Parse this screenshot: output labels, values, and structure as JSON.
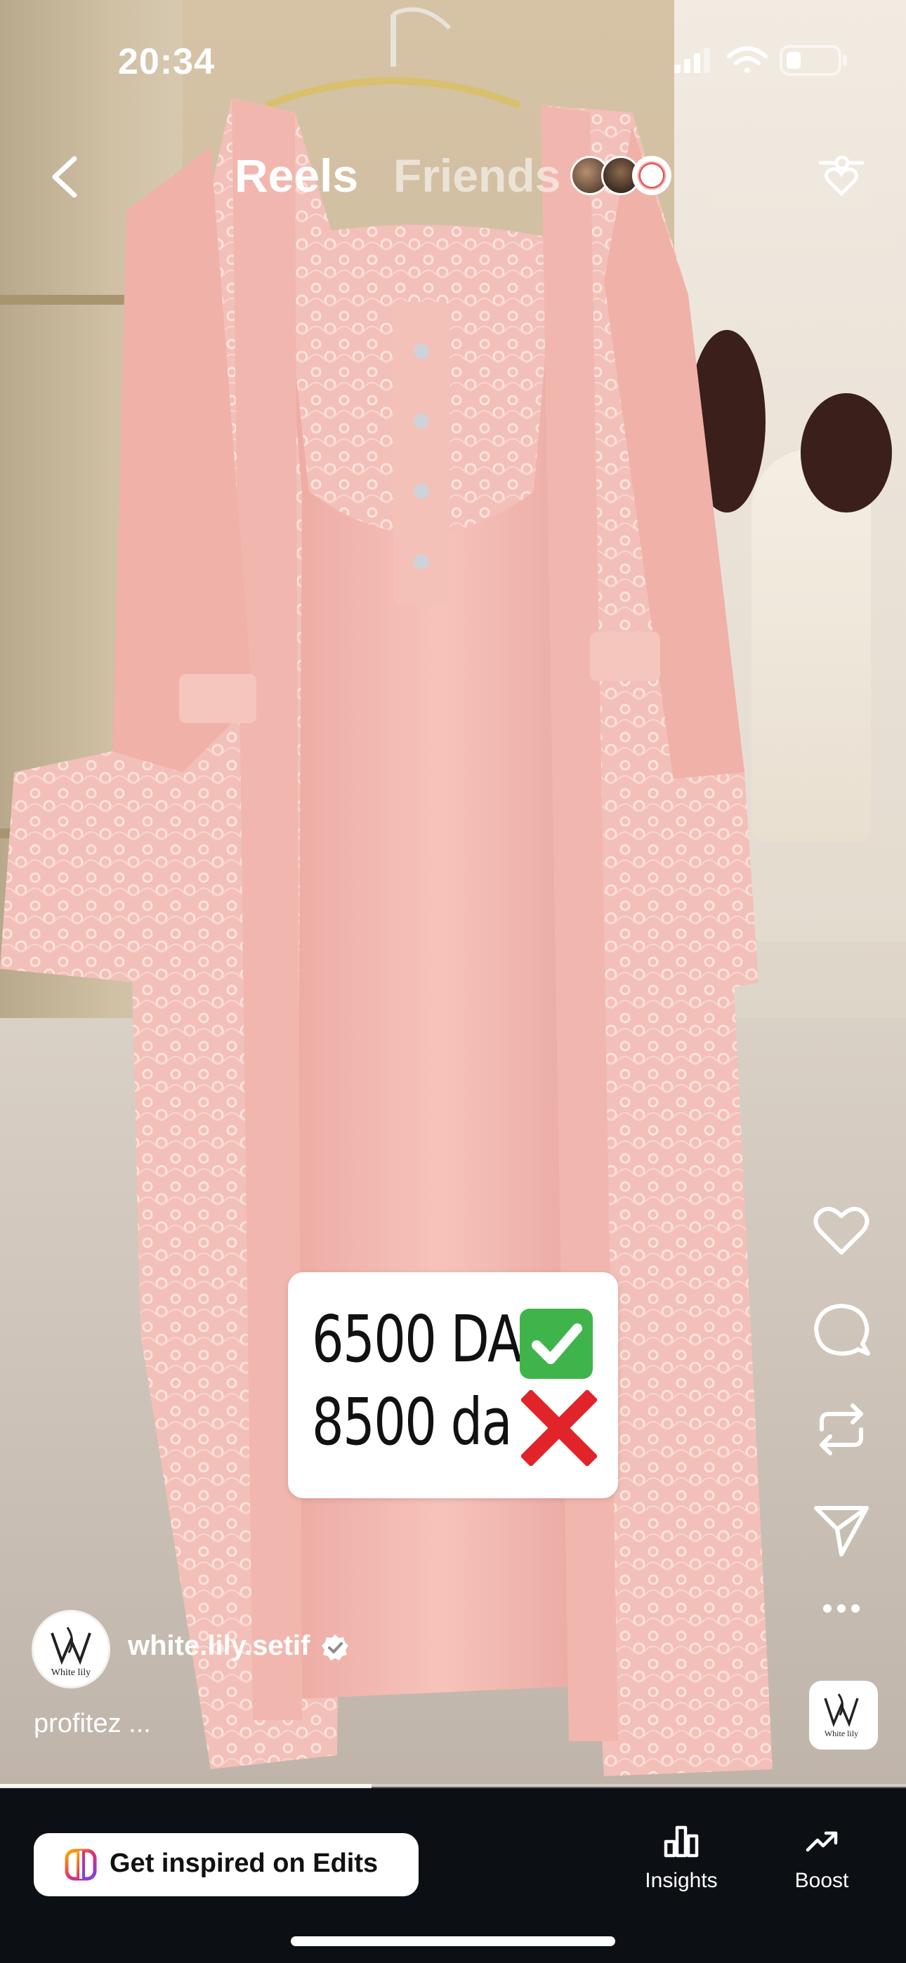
{
  "status_bar": {
    "time": "20:34"
  },
  "top_bar": {
    "tabs": [
      {
        "label": "Reels",
        "active": true
      },
      {
        "label": "Friends",
        "active": false
      }
    ]
  },
  "post": {
    "price_sticker": {
      "line1": "6500 DA",
      "line2": "8500 da"
    },
    "author": {
      "username": "white.lily.setif",
      "verified": true,
      "avatar_text": "White lily"
    },
    "caption": "profitez ...",
    "audio_thumb_text": "White lily",
    "progress": 0.41
  },
  "bottom_bar": {
    "edits_button": "Get inspired on Edits",
    "insights_label": "Insights",
    "boost_label": "Boost"
  },
  "colors": {
    "accent_white": "#ffffff",
    "bar_background": "#0c1014",
    "check_green": "#3fb44a",
    "cross_red": "#e0242a",
    "dress_pink": "#f2b8b0"
  },
  "icons": [
    "back-icon",
    "filter-settings-icon",
    "heart-icon",
    "comment-icon",
    "repost-icon",
    "share-icon",
    "more-icon",
    "verified-icon",
    "edits-icon",
    "insights-icon",
    "boost-icon"
  ]
}
